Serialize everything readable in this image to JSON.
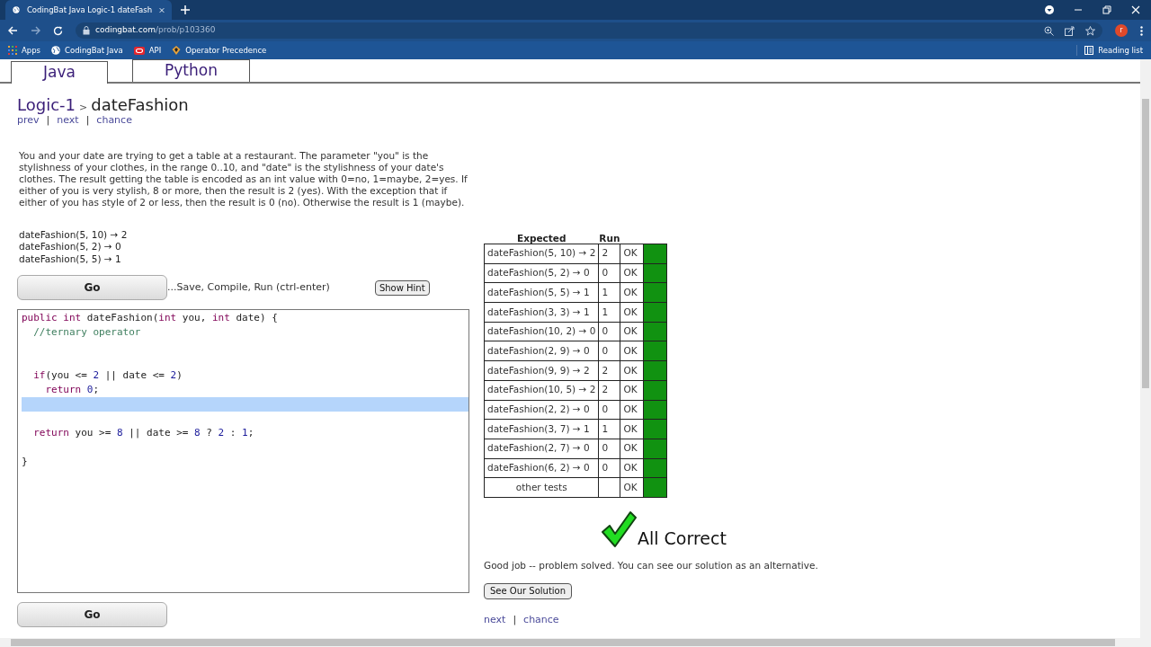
{
  "browser": {
    "tab_title": "CodingBat Java Logic-1 dateFash",
    "address_host": "codingbat.com",
    "address_path": "/prob/p103360",
    "bookmarks": [
      {
        "label": "Apps",
        "kind": "apps"
      },
      {
        "label": "CodingBat Java",
        "kind": "globe"
      },
      {
        "label": "API",
        "kind": "oracle"
      },
      {
        "label": "Operator Precedence",
        "kind": "shield"
      }
    ],
    "reading_list": "Reading list",
    "profile_initial": "r"
  },
  "lang_tabs": [
    {
      "label": "Java",
      "selected": true
    },
    {
      "label": "Python",
      "selected": false
    }
  ],
  "breadcrumb": {
    "section": "Logic-1",
    "separator": ">",
    "problem": "dateFashion"
  },
  "nav_links": [
    "prev",
    "next",
    "chance"
  ],
  "link_separator": "|",
  "description": "You and your date are trying to get a table at a restaurant. The parameter \"you\" is the stylishness of your clothes, in the range 0..10, and \"date\" is the stylishness of your date's clothes. The result getting the table is encoded as an int value with 0=no, 1=maybe, 2=yes. If either of you is very stylish, 8 or more, then the result is 2 (yes). With the exception that if either of you has style of 2 or less, then the result is 0 (no). Otherwise the result is 1 (maybe).",
  "examples": [
    "dateFashion(5, 10) → 2",
    "dateFashion(5, 2) → 0",
    "dateFashion(5, 5) → 1"
  ],
  "go_button": "Go",
  "go_hint": "...Save, Compile, Run (ctrl-enter)",
  "hint_button": "Show Hint",
  "code": [
    {
      "selected": false,
      "tokens": [
        {
          "t": "public ",
          "kind": "keyword"
        },
        {
          "t": "int",
          "kind": "keyword"
        },
        {
          "t": " dateFashion(",
          "kind": "plain"
        },
        {
          "t": "int",
          "kind": "keyword"
        },
        {
          "t": " you, ",
          "kind": "plain"
        },
        {
          "t": "int",
          "kind": "keyword"
        },
        {
          "t": " date) {",
          "kind": "plain"
        }
      ]
    },
    {
      "selected": false,
      "tokens": [
        {
          "t": "  //ternary operator",
          "kind": "comment"
        }
      ]
    },
    {
      "selected": false
    },
    {
      "selected": false
    },
    {
      "selected": false,
      "tokens": [
        {
          "t": "  if",
          "kind": "keyword"
        },
        {
          "t": "(you <= ",
          "kind": "plain"
        },
        {
          "t": "2",
          "kind": "number"
        },
        {
          "t": " || date <= ",
          "kind": "plain"
        },
        {
          "t": "2",
          "kind": "number"
        },
        {
          "t": ")",
          "kind": "plain"
        }
      ]
    },
    {
      "selected": false,
      "tokens": [
        {
          "t": "    return ",
          "kind": "keyword"
        },
        {
          "t": "0",
          "kind": "number"
        },
        {
          "t": ";",
          "kind": "plain"
        }
      ]
    },
    {
      "selected": true
    },
    {
      "selected": false
    },
    {
      "selected": false,
      "tokens": [
        {
          "t": "  return",
          "kind": "keyword"
        },
        {
          "t": " you >= ",
          "kind": "plain"
        },
        {
          "t": "8",
          "kind": "number"
        },
        {
          "t": " || date >= ",
          "kind": "plain"
        },
        {
          "t": "8",
          "kind": "number"
        },
        {
          "t": " ? ",
          "kind": "plain"
        },
        {
          "t": "2",
          "kind": "number"
        },
        {
          "t": " : ",
          "kind": "plain"
        },
        {
          "t": "1",
          "kind": "number"
        },
        {
          "t": ";",
          "kind": "plain"
        }
      ]
    },
    {
      "selected": false
    },
    {
      "selected": false,
      "tokens": [
        {
          "t": "}",
          "kind": "plain"
        }
      ]
    }
  ],
  "go_button_bottom": "Go",
  "results": {
    "columns": [
      "Expected",
      "Run"
    ],
    "rows": [
      {
        "expected": "dateFashion(5, 10) → 2",
        "run": "2",
        "result": "OK",
        "passed": true
      },
      {
        "expected": "dateFashion(5, 2) → 0",
        "run": "0",
        "result": "OK",
        "passed": true
      },
      {
        "expected": "dateFashion(5, 5) → 1",
        "run": "1",
        "result": "OK",
        "passed": true
      },
      {
        "expected": "dateFashion(3, 3) → 1",
        "run": "1",
        "result": "OK",
        "passed": true
      },
      {
        "expected": "dateFashion(10, 2) → 0",
        "run": "0",
        "result": "OK",
        "passed": true
      },
      {
        "expected": "dateFashion(2, 9) → 0",
        "run": "0",
        "result": "OK",
        "passed": true
      },
      {
        "expected": "dateFashion(9, 9) → 2",
        "run": "2",
        "result": "OK",
        "passed": true
      },
      {
        "expected": "dateFashion(10, 5) → 2",
        "run": "2",
        "result": "OK",
        "passed": true
      },
      {
        "expected": "dateFashion(2, 2) → 0",
        "run": "0",
        "result": "OK",
        "passed": true
      },
      {
        "expected": "dateFashion(3, 7) → 1",
        "run": "1",
        "result": "OK",
        "passed": true
      },
      {
        "expected": "dateFashion(2, 7) → 0",
        "run": "0",
        "result": "OK",
        "passed": true
      },
      {
        "expected": "dateFashion(6, 2) → 0",
        "run": "0",
        "result": "OK",
        "passed": true
      },
      {
        "expected": "other tests",
        "result": "OK",
        "passed": true,
        "kind": "summary"
      }
    ]
  },
  "verdict": "All Correct",
  "verdict_note": "Good job -- problem solved. You can see our solution as an alternative.",
  "solution_button": "See Our Solution",
  "bottom_links": [
    "next",
    "chance"
  ]
}
